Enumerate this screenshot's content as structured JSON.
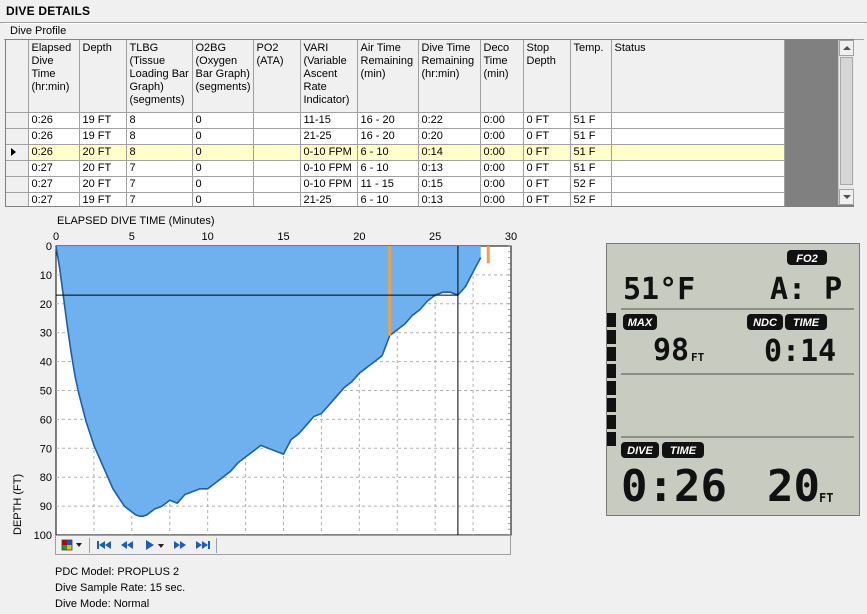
{
  "header": {
    "title": "DIVE DETAILS",
    "section": "Dive Profile"
  },
  "grid": {
    "columns": [
      "Elapsed Dive Time (hr:min)",
      "Depth",
      "TLBG (Tissue Loading Bar Graph) (segments)",
      "O2BG (Oxygen Bar Graph) (segments)",
      "PO2 (ATA)",
      "VARI (Variable Ascent Rate Indicator)",
      "Air Time Remaining (min)",
      "Dive Time Remaining (hr:min)",
      "Deco Time (min)",
      "Stop Depth",
      "Temp.",
      "Status"
    ],
    "rows": [
      [
        "0:26",
        "19 FT",
        "8",
        "0",
        "",
        "11-15",
        "16 - 20",
        "0:22",
        "0:00",
        "0 FT",
        "51 F",
        ""
      ],
      [
        "0:26",
        "19 FT",
        "8",
        "0",
        "",
        "21-25",
        "16 - 20",
        "0:20",
        "0:00",
        "0 FT",
        "51 F",
        ""
      ],
      [
        "0:26",
        "20 FT",
        "8",
        "0",
        "",
        "0-10 FPM",
        "6 - 10",
        "0:14",
        "0:00",
        "0 FT",
        "51 F",
        ""
      ],
      [
        "0:27",
        "20 FT",
        "7",
        "0",
        "",
        "0-10 FPM",
        "6 - 10",
        "0:13",
        "0:00",
        "0 FT",
        "51 F",
        ""
      ],
      [
        "0:27",
        "20 FT",
        "7",
        "0",
        "",
        "0-10 FPM",
        "11 - 15",
        "0:15",
        "0:00",
        "0 FT",
        "52 F",
        ""
      ],
      [
        "0:27",
        "19 FT",
        "7",
        "0",
        "",
        "21-25",
        "6 - 10",
        "0:13",
        "0:00",
        "0 FT",
        "52 F",
        ""
      ]
    ],
    "selected_row": 2
  },
  "chart_data": {
    "type": "area",
    "title": "ELAPSED DIVE TIME (Minutes)",
    "xlabel": "",
    "ylabel": "DEPTH (FT)",
    "xlim": [
      0,
      30
    ],
    "ylim": [
      0,
      100
    ],
    "x_ticks": [
      0,
      5,
      10,
      15,
      20,
      25,
      30
    ],
    "y_ticks": [
      0,
      10,
      20,
      30,
      40,
      50,
      60,
      70,
      80,
      90,
      100
    ],
    "grid": true,
    "cursor_x": 26.5,
    "cursor_y": 17,
    "series": [
      {
        "x": [
          0,
          0.25,
          0.5,
          0.75,
          1,
          1.25,
          1.5,
          1.75,
          2,
          2.25,
          2.5,
          2.75,
          3,
          3.25,
          3.5,
          3.75,
          4,
          4.25,
          4.5,
          4.75,
          5,
          5.25,
          5.5,
          5.75,
          6,
          6.5,
          7,
          7.5,
          8,
          8.5,
          9,
          9.5,
          10,
          10.5,
          11,
          11.5,
          12,
          12.5,
          13,
          13.5,
          14,
          14.5,
          15,
          15.5,
          16,
          16.5,
          17,
          17.5,
          18,
          18.5,
          19,
          19.5,
          20,
          20.5,
          21,
          21.5,
          22,
          22.5,
          23,
          23.5,
          24,
          24.5,
          25,
          25.5,
          26,
          26.5,
          27,
          27.5,
          28
        ],
        "values": [
          0,
          8,
          18,
          28,
          37,
          45,
          51,
          56,
          61,
          65,
          69,
          72,
          75,
          78,
          81,
          84,
          86,
          88,
          90,
          91,
          92,
          93,
          93.5,
          93.5,
          93,
          91,
          90,
          88,
          89,
          86,
          85,
          84,
          84,
          82,
          80,
          78,
          75,
          73,
          71,
          69,
          70,
          71,
          72,
          67,
          65,
          62,
          59,
          58,
          55,
          52,
          49,
          47,
          44,
          42,
          40,
          38,
          31,
          29,
          27,
          24,
          22,
          19,
          17,
          16,
          16,
          17,
          14,
          9,
          4
        ]
      }
    ],
    "markers": [
      {
        "x": 22,
        "y_from": 0,
        "y_to": 31,
        "color": "#f0a050"
      },
      {
        "x": 28.5,
        "y_from": 0,
        "y_to": 6,
        "color": "#f0a050"
      }
    ]
  },
  "toolbar": {
    "buttons": [
      "palette-icon",
      "first-icon",
      "prev-icon",
      "play-icon",
      "next-icon",
      "last-icon"
    ]
  },
  "info": {
    "pdc_model": "PDC Model: PROPLUS 2",
    "sample_rate": "Dive Sample Rate: 15 sec.",
    "dive_mode": "Dive Mode: Normal"
  },
  "lcd": {
    "fo2_label": "FO2",
    "temp": "51°F",
    "fo2_value": "A: P",
    "max_label": "MAX",
    "max_value": "98",
    "ndc_label": "NDC",
    "time_label": "TIME",
    "ndc_value": "0:14",
    "dive_label": "DIVE",
    "dive_time": "0:26",
    "depth_value": "20",
    "unit": "FT"
  },
  "colors": {
    "area_fill": "#6fb0ee",
    "area_stroke": "#1f5fa0",
    "selected_row": "#ffffcc",
    "lcd_bg": "#c8ccc0",
    "marker": "#f0a050"
  }
}
